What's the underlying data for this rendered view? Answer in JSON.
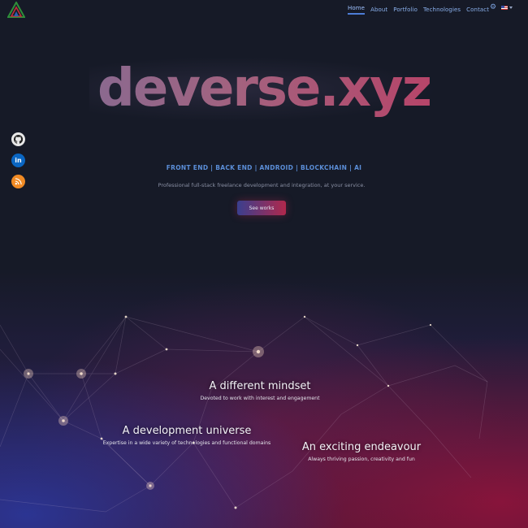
{
  "nav": {
    "items": [
      {
        "label": "Home",
        "active": true
      },
      {
        "label": "About",
        "active": false
      },
      {
        "label": "Portfolio",
        "active": false
      },
      {
        "label": "Technologies",
        "active": false
      },
      {
        "label": "Contact",
        "active": false
      }
    ],
    "settings_icon": "gear-icon",
    "language_flag": "uk-flag-icon"
  },
  "hero": {
    "title": "deverse.xyz",
    "tagline": "FRONT END | BACK END | ANDROID | BLOCKCHAIN | AI",
    "subtitle": "Professional full-stack freelance development and integration, at your service.",
    "cta_label": "See works"
  },
  "social": [
    {
      "name": "github-icon",
      "glyph": "◉"
    },
    {
      "name": "linkedin-icon",
      "glyph": "in"
    },
    {
      "name": "rss-icon",
      "glyph": "◔"
    }
  ],
  "features": [
    {
      "title": "A different mindset",
      "text": "Devoted to work with interest and engagement"
    },
    {
      "title": "A development universe",
      "text": "Expertise in a wide variety of technologies and functional domains"
    },
    {
      "title": "An exciting endeavour",
      "text": "Always thriving passion, creativity and fun"
    }
  ],
  "colors": {
    "background": "#161a27",
    "nav_link": "#8ab0ec",
    "tagline": "#5b8ed8",
    "accent_blue": "#3a3f8e",
    "accent_red": "#b0284c"
  }
}
